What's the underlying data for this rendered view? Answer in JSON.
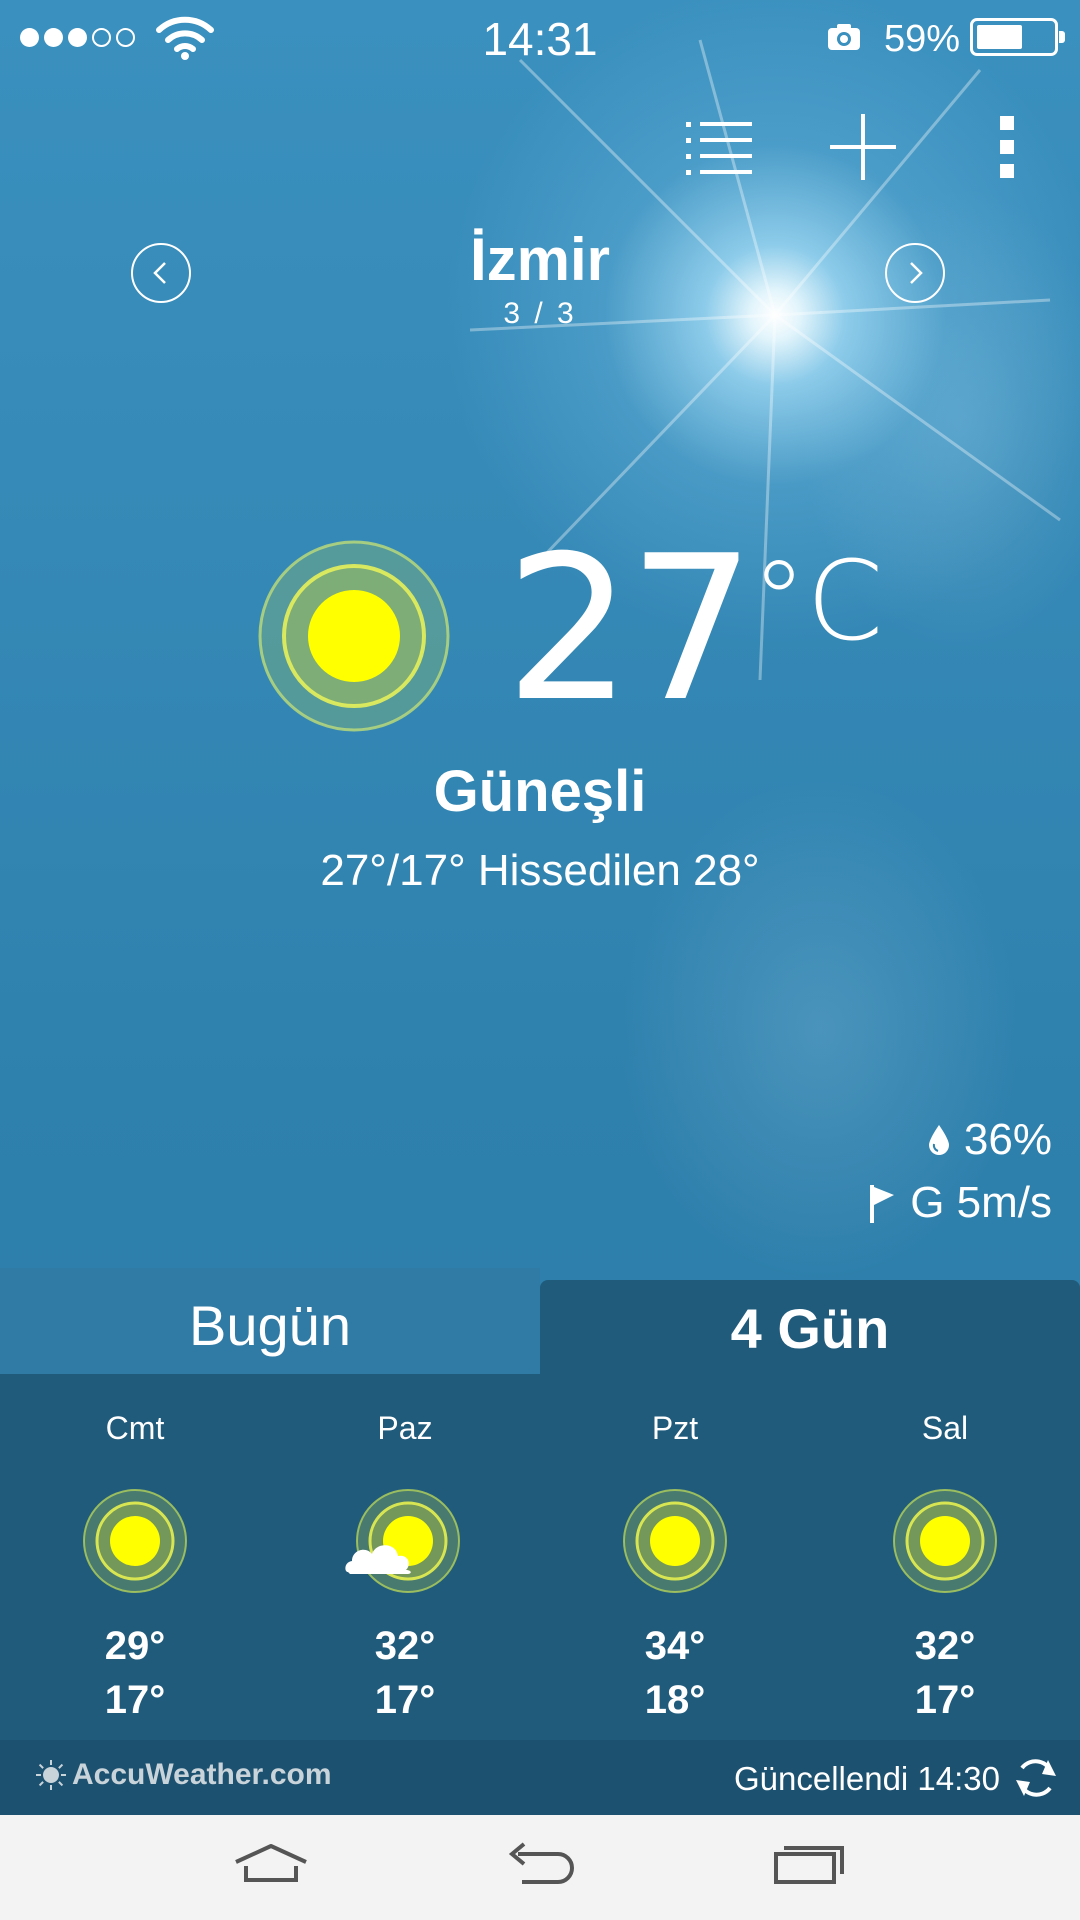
{
  "status_bar": {
    "time": "14:31",
    "battery_percent": "59%",
    "signal_bars_filled": 3,
    "signal_bars_total": 5,
    "battery_level": 0.59
  },
  "toolbar": {
    "list_icon": "list-icon",
    "add_icon": "plus-icon",
    "menu_icon": "more-vertical-icon"
  },
  "location": {
    "city": "İzmir",
    "index": "3 / 3"
  },
  "current": {
    "temperature": "27",
    "unit": "°C",
    "condition": "Güneşli",
    "range_feels": "27°/17° Hissedilen 28°",
    "humidity": "36%",
    "wind": "G 5m/s",
    "icon": "sun-icon"
  },
  "tabs": {
    "today": "Bugün",
    "four_day": "4 Gün",
    "active": "four_day"
  },
  "forecast": [
    {
      "day": "Cmt",
      "high": "29°",
      "low": "17°",
      "icon": "sun-icon"
    },
    {
      "day": "Paz",
      "high": "32°",
      "low": "17°",
      "icon": "partly-cloudy-icon"
    },
    {
      "day": "Pzt",
      "high": "34°",
      "low": "18°",
      "icon": "sun-icon"
    },
    {
      "day": "Sal",
      "high": "32°",
      "low": "17°",
      "icon": "sun-icon"
    }
  ],
  "footer": {
    "provider": "AccuWeather.com",
    "updated": "Güncellendi 14:30"
  },
  "colors": {
    "sun_yellow": "#ffff00",
    "panel": "#205b7c",
    "footer": "#1d5170"
  }
}
